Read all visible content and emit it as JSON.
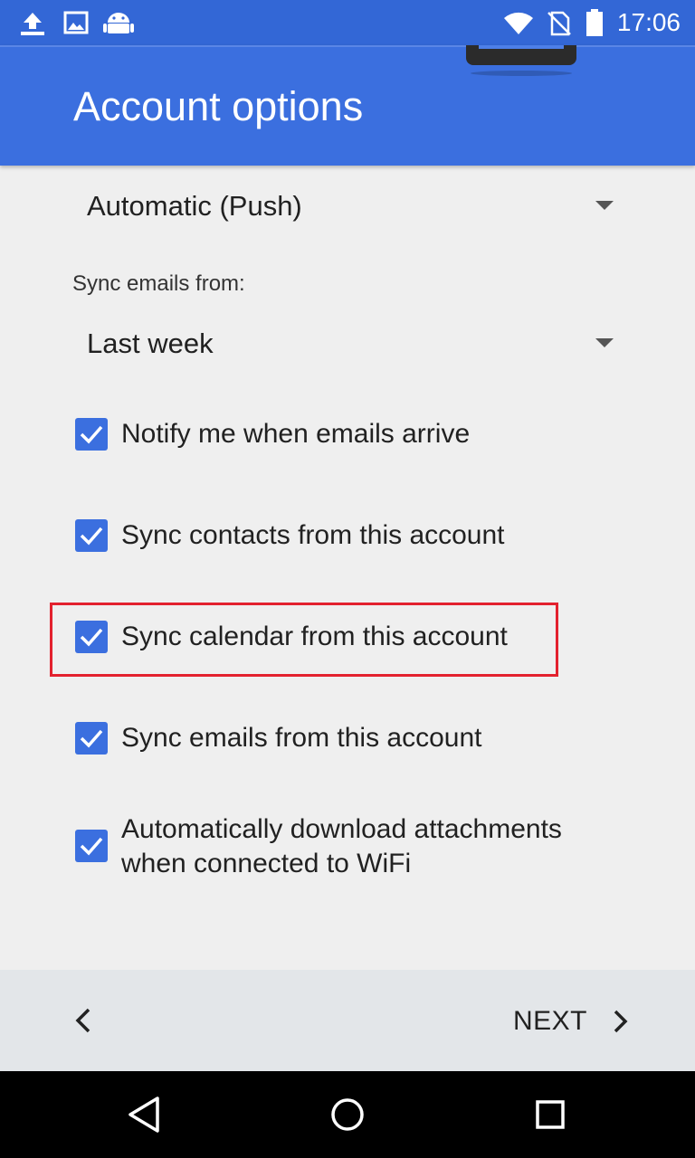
{
  "status_bar": {
    "time": "17:06",
    "left_icons": [
      "upload-icon",
      "image-icon",
      "android-icon"
    ],
    "right_icons": [
      "wifi-icon",
      "no-sim-icon",
      "battery-icon"
    ]
  },
  "header": {
    "title": "Account options"
  },
  "sync_frequency": {
    "selected": "Automatic (Push)"
  },
  "sync_window": {
    "label": "Sync emails from:",
    "selected": "Last week"
  },
  "options": [
    {
      "label": "Notify me when emails arrive",
      "checked": true
    },
    {
      "label": "Sync contacts from this account",
      "checked": true
    },
    {
      "label": "Sync calendar from this account",
      "checked": true
    },
    {
      "label": "Sync emails from this account",
      "checked": true
    },
    {
      "label": "Automatically download attachments when connected to WiFi",
      "checked": true
    }
  ],
  "footer": {
    "next_label": "NEXT"
  },
  "colors": {
    "accent": "#3b6fdf",
    "highlight": "#e3212e"
  }
}
